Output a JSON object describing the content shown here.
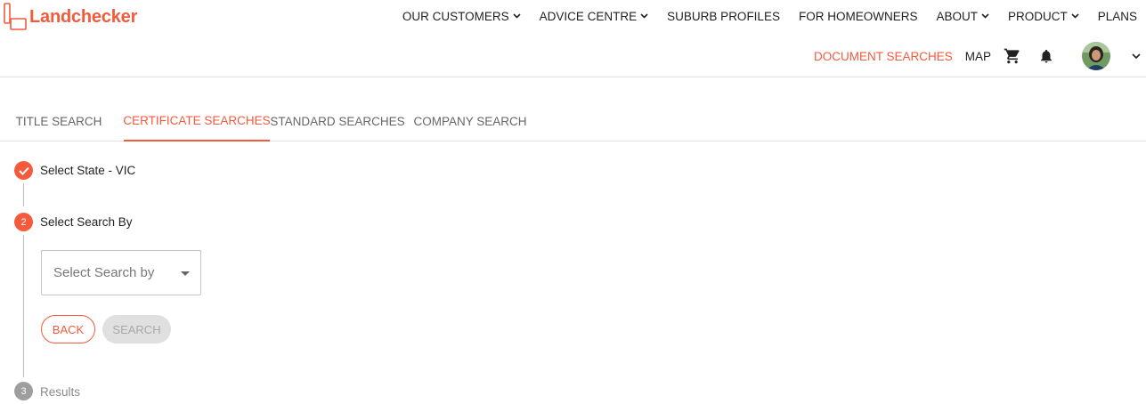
{
  "brand": {
    "name": "Landchecker",
    "accent_color": "#f55a3c"
  },
  "topnav": {
    "items": [
      {
        "label": "OUR CUSTOMERS",
        "has_dropdown": true
      },
      {
        "label": "ADVICE CENTRE",
        "has_dropdown": true
      },
      {
        "label": "SUBURB PROFILES",
        "has_dropdown": false
      },
      {
        "label": "FOR HOMEOWNERS",
        "has_dropdown": false
      },
      {
        "label": "ABOUT",
        "has_dropdown": true
      },
      {
        "label": "PRODUCT",
        "has_dropdown": true
      },
      {
        "label": "PLANS",
        "has_dropdown": false
      }
    ]
  },
  "subnav": {
    "document_searches": "DOCUMENT SEARCHES",
    "map": "MAP",
    "icons": [
      "cart-icon",
      "bell-icon",
      "avatar",
      "chevron-down-icon"
    ]
  },
  "tabs": {
    "items": [
      "TITLE SEARCH",
      "CERTIFICATE SEARCHES",
      "STANDARD SEARCHES",
      "COMPANY SEARCH"
    ],
    "active": "CERTIFICATE SEARCHES"
  },
  "stepper": {
    "steps": [
      {
        "number": "1",
        "label": "Select State - VIC",
        "status": "complete",
        "icon": "check-icon"
      },
      {
        "number": "2",
        "label": "Select Search By",
        "status": "active"
      },
      {
        "number": "3",
        "label": "Results",
        "status": "pending"
      }
    ],
    "select": {
      "placeholder": "Select Search by"
    },
    "buttons": {
      "back": "BACK",
      "search": "SEARCH"
    }
  }
}
